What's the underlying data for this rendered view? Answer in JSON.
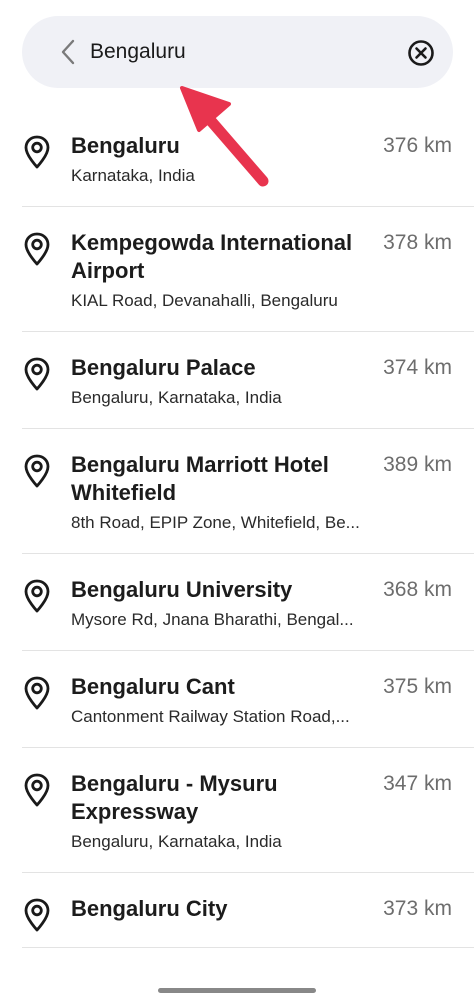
{
  "search": {
    "value": "Bengaluru"
  },
  "results": [
    {
      "name": "Bengaluru",
      "address": "Karnataka, India",
      "distance": "376 km"
    },
    {
      "name": "Kempegowda International Airport",
      "address": "KIAL Road, Devanahalli, Bengaluru",
      "distance": "378 km"
    },
    {
      "name": "Bengaluru Palace",
      "address": "Bengaluru, Karnataka, India",
      "distance": "374 km"
    },
    {
      "name": "Bengaluru Marriott Hotel Whitefield",
      "address": "8th Road, EPIP Zone, Whitefield, Be...",
      "distance": "389 km"
    },
    {
      "name": "Bengaluru University",
      "address": "Mysore Rd, Jnana Bharathi, Bengal...",
      "distance": "368 km"
    },
    {
      "name": "Bengaluru Cant",
      "address": "Cantonment Railway Station Road,...",
      "distance": "375 km"
    },
    {
      "name": "Bengaluru - Mysuru Expressway",
      "address": "Bengaluru, Karnataka, India",
      "distance": "347 km"
    },
    {
      "name": "Bengaluru City",
      "address": "",
      "distance": "373 km"
    }
  ],
  "icons": {
    "back": "chevron-left-icon",
    "clear": "close-circle-icon",
    "pin": "location-pin-icon",
    "annotation": "red-arrow-annotation"
  },
  "colors": {
    "search_bg": "#f0f1f6",
    "arrow": "#e8344e",
    "distance": "#6d6d6d"
  }
}
